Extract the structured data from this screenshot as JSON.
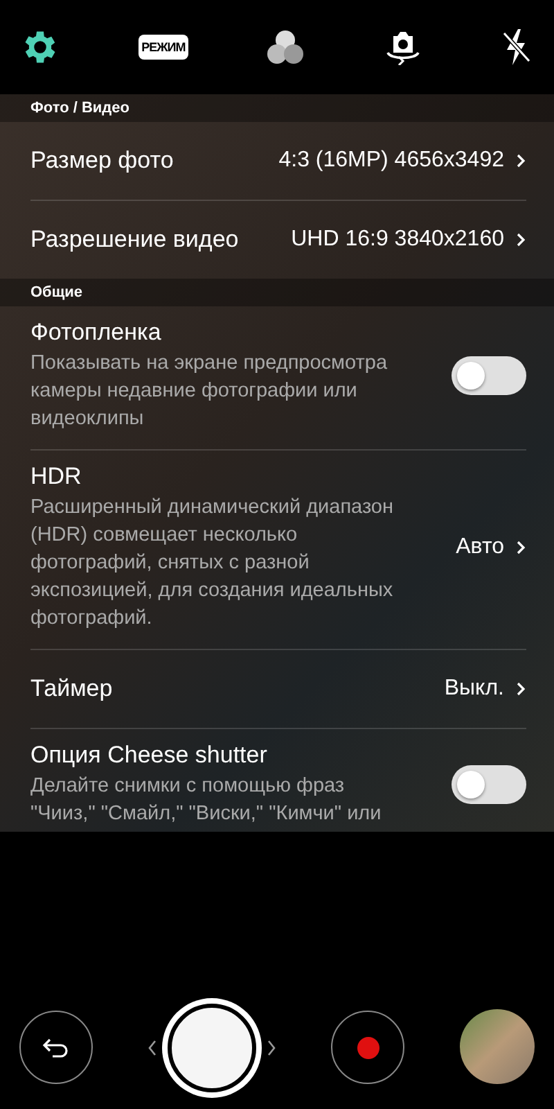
{
  "toolbar": [
    {
      "kind": "settings",
      "selected": true
    },
    {
      "kind": "mode",
      "label": "РЕЖИМ",
      "selected": false
    },
    {
      "kind": "filters",
      "selected": false
    },
    {
      "kind": "switch-camera",
      "selected": false
    },
    {
      "kind": "flash",
      "selected": false
    }
  ],
  "sections": [
    {
      "title": "Фото / Видео",
      "items": [
        {
          "kind": "value",
          "label": "Размер фото",
          "value": "4:3 (16MP) 4656x3492"
        },
        {
          "kind": "value",
          "label": "Разрешение видео",
          "value": "UHD 16:9 3840x2160"
        }
      ]
    },
    {
      "title": "Общие",
      "items": [
        {
          "kind": "toggle",
          "label": "Фотопленка",
          "description": "Показывать на экране предпросмотра камеры недавние фотографии или видеоклипы",
          "on": false
        },
        {
          "kind": "value",
          "label": "HDR",
          "description": "Расширенный динамический диапазон (HDR) совмещает несколько фотографий, снятых с разной экспозицией, для создания идеальных фотографий.",
          "value": "Авто"
        },
        {
          "kind": "value",
          "label": "Таймер",
          "value": "Выкл."
        },
        {
          "kind": "toggle",
          "label": "Опция Cheese shutter",
          "description": "Делайте снимки с помощью фраз \"Чииз,\" \"Смайл,\" \"Виски,\" \"Кимчи\" или",
          "on": false
        }
      ]
    }
  ]
}
